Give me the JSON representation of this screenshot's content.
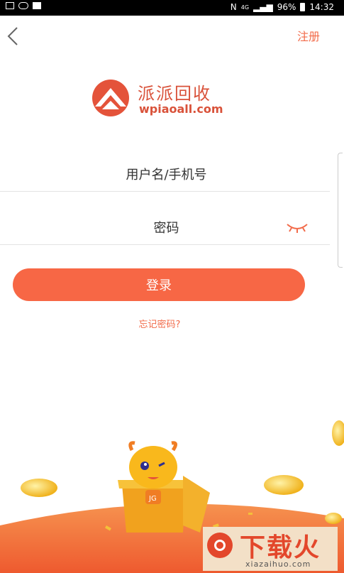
{
  "status_bar": {
    "battery": "96%",
    "time": "14:32",
    "network_label": "4G",
    "nfc": "N"
  },
  "nav": {
    "register_label": "注册",
    "back_icon": "chevron-left-icon"
  },
  "logo": {
    "name_cn": "派派回收",
    "domain": "wpiaoall.com"
  },
  "form": {
    "username_placeholder": "用户名/手机号",
    "password_placeholder": "密码",
    "login_label": "登录",
    "forgot_label": "忘记密码?"
  },
  "watermark": {
    "title": "下载火",
    "subtitle": "xiazaihuo.com"
  },
  "colors": {
    "accent": "#f76745",
    "link": "#f26b4a"
  }
}
